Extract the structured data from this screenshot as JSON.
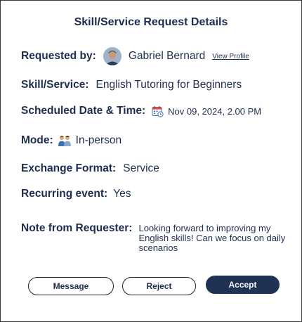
{
  "dialog": {
    "title": "Skill/Service Request Details"
  },
  "requester": {
    "label": "Requested by:",
    "name": "Gabriel Bernard",
    "view_profile_label": "View Profile"
  },
  "skill": {
    "label": "Skill/Service:",
    "value": "English Tutoring for Beginners"
  },
  "schedule": {
    "label": "Scheduled Date & Time:",
    "icon": "calendar-icon",
    "value": "Nov 09, 2024, 2.00 PM"
  },
  "mode": {
    "label": "Mode:",
    "icon": "people-icon",
    "value": "In-person"
  },
  "exchange": {
    "label": "Exchange Format:",
    "value": "Service"
  },
  "recurring": {
    "label": "Recurring event:",
    "value": "Yes"
  },
  "note": {
    "label": "Note from Requester:",
    "value": "Looking forward to improving my English skills! Can we focus on daily scenarios"
  },
  "actions": {
    "message_label": "Message",
    "reject_label": "Reject",
    "accept_label": "Accept"
  },
  "colors": {
    "primary": "#1f3254",
    "text": "#1e2d4f"
  }
}
